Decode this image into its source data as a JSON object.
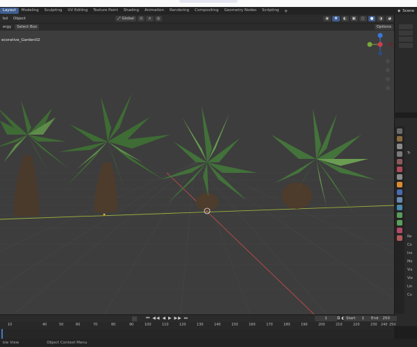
{
  "workspace_tabs": [
    "Layout",
    "Modeling",
    "Sculpting",
    "UV Editing",
    "Texture Paint",
    "Shading",
    "Animation",
    "Rendering",
    "Compositing",
    "Geometry Nodes",
    "Scripting"
  ],
  "workspace_add": "+",
  "scene_label": "Scene",
  "header": {
    "mode": "bd",
    "object_menu": "Object",
    "orientation": "Global"
  },
  "toolbar": {
    "tool_label": "ergy",
    "select_mode": "Select Box",
    "options": "Options"
  },
  "viewport": {
    "object_name": "ecorative_Garden02"
  },
  "timeline": {
    "ticks": [
      "10",
      "40",
      "50",
      "60",
      "70",
      "80",
      "90",
      "100",
      "110",
      "120",
      "130",
      "140",
      "150",
      "160",
      "170",
      "180",
      "190",
      "200",
      "210",
      "220",
      "230",
      "240",
      "250"
    ],
    "current_frame": "1",
    "start_label": "Start",
    "start_value": "1",
    "end_label": "End",
    "end_value": "250"
  },
  "status": {
    "left": "ble View",
    "middle": "Object Context Menu"
  },
  "properties": {
    "labels": [
      "Tr",
      "Re",
      "Co",
      "Ins",
      "Mo",
      "Vis",
      "Vie",
      "Lin",
      "Cu"
    ]
  },
  "colors": {
    "accent": "#3f5d8f",
    "viewport_bg": "#3d3d3d",
    "x_axis": "#c24a4a",
    "y_axis": "#9bb33c"
  }
}
